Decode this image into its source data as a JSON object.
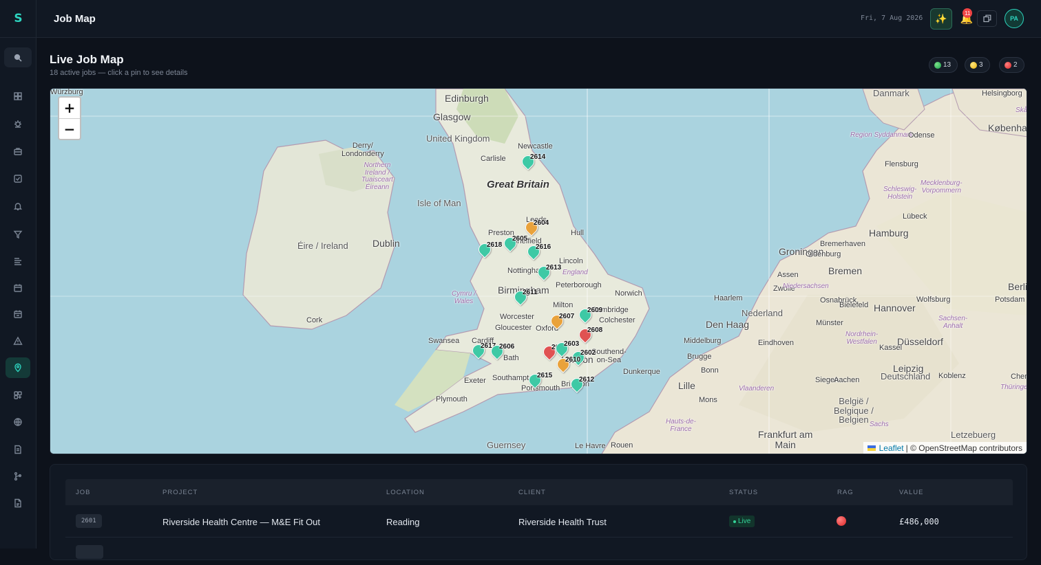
{
  "app": {
    "logo": "S",
    "title": "Job Map",
    "date": "Fri, 7 Aug 2026",
    "notifications_count": "11",
    "user_initials": "PA"
  },
  "sidebar": {
    "icons": [
      "search-icon",
      "dashboard-icon",
      "bug-icon",
      "briefcase-icon",
      "checkbox-icon",
      "bell-icon",
      "filter-icon",
      "list-icon",
      "calendar-icon",
      "calendar-alt-icon",
      "warning-icon",
      "map-pin-icon",
      "apps-icon",
      "globe-icon",
      "document-icon",
      "branch-icon",
      "file-icon"
    ],
    "active": "map-pin-icon"
  },
  "page": {
    "title": "Live Job Map",
    "subtitle": "18 active jobs — click a pin to see details",
    "rag_counts": {
      "green": "13",
      "amber": "3",
      "red": "2"
    }
  },
  "map": {
    "zoom_in": "+",
    "zoom_out": "−",
    "attribution_link": "Leaflet",
    "attribution_text": "| © OpenStreetMap contributors",
    "places": [
      {
        "t": "Edinburgh",
        "c": "big"
      },
      {
        "t": "Glasgow",
        "c": "big"
      },
      {
        "t": "United Kingdom",
        "c": "country"
      },
      {
        "t": "Newcastle",
        "c": ""
      },
      {
        "t": "Carlisle",
        "c": ""
      },
      {
        "t": "Great Britain",
        "c": "huge"
      },
      {
        "t": "Isle of Man",
        "c": "country"
      },
      {
        "t": "Derry/\nLondonderry",
        "c": ""
      },
      {
        "t": "Northern\nIreland /\nTuaisceart\nÉireann",
        "c": "region"
      },
      {
        "t": "Éire / Ireland",
        "c": "country"
      },
      {
        "t": "Dublin",
        "c": "big"
      },
      {
        "t": "Cork",
        "c": ""
      },
      {
        "t": "Leeds",
        "c": ""
      },
      {
        "t": "Preston",
        "c": ""
      },
      {
        "t": "Sheffield",
        "c": ""
      },
      {
        "t": "Hull",
        "c": ""
      },
      {
        "t": "Lincoln",
        "c": ""
      },
      {
        "t": "England",
        "c": "region"
      },
      {
        "t": "Nottingham",
        "c": ""
      },
      {
        "t": "Peterborough",
        "c": ""
      },
      {
        "t": "Birmingham",
        "c": "big"
      },
      {
        "t": "Norwich",
        "c": ""
      },
      {
        "t": "Cambridge",
        "c": ""
      },
      {
        "t": "Cymru /\nWales",
        "c": "region"
      },
      {
        "t": "Worcester",
        "c": ""
      },
      {
        "t": "Milton",
        "c": ""
      },
      {
        "t": "Colchester",
        "c": ""
      },
      {
        "t": "Gloucester",
        "c": ""
      },
      {
        "t": "Oxford",
        "c": ""
      },
      {
        "t": "Swansea",
        "c": ""
      },
      {
        "t": "Cardiff",
        "c": ""
      },
      {
        "t": "Bath",
        "c": ""
      },
      {
        "t": "London",
        "c": "big"
      },
      {
        "t": "Southend-\non-Sea",
        "c": ""
      },
      {
        "t": "Exeter",
        "c": ""
      },
      {
        "t": "Southampton",
        "c": ""
      },
      {
        "t": "Portsmouth",
        "c": ""
      },
      {
        "t": "Brighton",
        "c": ""
      },
      {
        "t": "Plymouth",
        "c": ""
      },
      {
        "t": "Guernsey",
        "c": "country"
      },
      {
        "t": "Le Havre",
        "c": ""
      },
      {
        "t": "Rouen",
        "c": ""
      },
      {
        "t": "Dunkerque",
        "c": ""
      },
      {
        "t": "Lille",
        "c": "big"
      },
      {
        "t": "Mons",
        "c": ""
      },
      {
        "t": "Hauts-de-\nFrance",
        "c": "region"
      },
      {
        "t": "Brugge",
        "c": ""
      },
      {
        "t": "Middelburg",
        "c": ""
      },
      {
        "t": "Den Haag",
        "c": "big"
      },
      {
        "t": "Haarlem",
        "c": ""
      },
      {
        "t": "Nederland",
        "c": "country"
      },
      {
        "t": "Eindhoven",
        "c": ""
      },
      {
        "t": "Zwolle",
        "c": ""
      },
      {
        "t": "Assen",
        "c": ""
      },
      {
        "t": "Groningen",
        "c": "big"
      },
      {
        "t": "Oldenburg",
        "c": ""
      },
      {
        "t": "Bremerhaven",
        "c": ""
      },
      {
        "t": "Bremen",
        "c": "big"
      },
      {
        "t": "Hamburg",
        "c": "big"
      },
      {
        "t": "Lübeck",
        "c": ""
      },
      {
        "t": "Mecklenburg-\nVorpommern",
        "c": "region"
      },
      {
        "t": "Schleswig-\nHolstein",
        "c": "region"
      },
      {
        "t": "Flensburg",
        "c": ""
      },
      {
        "t": "Region Syddanmark",
        "c": "region"
      },
      {
        "t": "Odense",
        "c": ""
      },
      {
        "t": "Danmark",
        "c": "country"
      },
      {
        "t": "Helsingborg",
        "c": ""
      },
      {
        "t": "København",
        "c": "big"
      },
      {
        "t": "Skån",
        "c": "region"
      },
      {
        "t": "Niedersachsen",
        "c": "region"
      },
      {
        "t": "Osnabrück",
        "c": ""
      },
      {
        "t": "Hannover",
        "c": "big"
      },
      {
        "t": "Wolfsburg",
        "c": ""
      },
      {
        "t": "Berlin",
        "c": "big"
      },
      {
        "t": "Potsdam",
        "c": ""
      },
      {
        "t": "Sachsen-\nAnhalt",
        "c": "region"
      },
      {
        "t": "Münster",
        "c": ""
      },
      {
        "t": "Bielefeld",
        "c": ""
      },
      {
        "t": "Nordrhein-\nWestfalen",
        "c": "region"
      },
      {
        "t": "Düsseldorf",
        "c": "big"
      },
      {
        "t": "Kassel",
        "c": ""
      },
      {
        "t": "Leipzig",
        "c": "big"
      },
      {
        "t": "Deutschland",
        "c": "country"
      },
      {
        "t": "Siegen",
        "c": ""
      },
      {
        "t": "Aachen",
        "c": ""
      },
      {
        "t": "Bonn",
        "c": ""
      },
      {
        "t": "Vlaanderen",
        "c": "region"
      },
      {
        "t": "België /\nBelgique /\nBelgien",
        "c": "country"
      },
      {
        "t": "Koblenz",
        "c": ""
      },
      {
        "t": "Thüringen",
        "c": "region"
      },
      {
        "t": "Chemnitz",
        "c": ""
      },
      {
        "t": "Sachs",
        "c": "region"
      },
      {
        "t": "Frankfurt am\nMain",
        "c": "big"
      },
      {
        "t": "Letzebuerg",
        "c": "country"
      },
      {
        "t": "Würzburg",
        "c": ""
      }
    ],
    "pins": [
      {
        "id": "2614",
        "rag": "green"
      },
      {
        "id": "2604",
        "rag": "amber"
      },
      {
        "id": "2605",
        "rag": "green"
      },
      {
        "id": "2618",
        "rag": "green"
      },
      {
        "id": "2616",
        "rag": "green"
      },
      {
        "id": "2613",
        "rag": "green"
      },
      {
        "id": "2611",
        "rag": "green"
      },
      {
        "id": "2609",
        "rag": "green"
      },
      {
        "id": "2607",
        "rag": "amber"
      },
      {
        "id": "2608",
        "rag": "red"
      },
      {
        "id": "2617",
        "rag": "green"
      },
      {
        "id": "2606",
        "rag": "green"
      },
      {
        "id": "2601",
        "rag": "red"
      },
      {
        "id": "2603",
        "rag": "green"
      },
      {
        "id": "2602",
        "rag": "green"
      },
      {
        "id": "2610",
        "rag": "amber"
      },
      {
        "id": "2615",
        "rag": "green"
      },
      {
        "id": "2612",
        "rag": "green"
      }
    ]
  },
  "table": {
    "headers": {
      "job": "JOB",
      "project": "PROJECT",
      "location": "LOCATION",
      "client": "CLIENT",
      "status": "STATUS",
      "rag": "RAG",
      "value": "VALUE"
    },
    "rows": [
      {
        "job": "2601",
        "project": "Riverside Health Centre — M&E Fit Out",
        "location": "Reading",
        "client": "Riverside Health Trust",
        "status": "Live",
        "rag": "red",
        "value": "£486,000"
      }
    ]
  }
}
